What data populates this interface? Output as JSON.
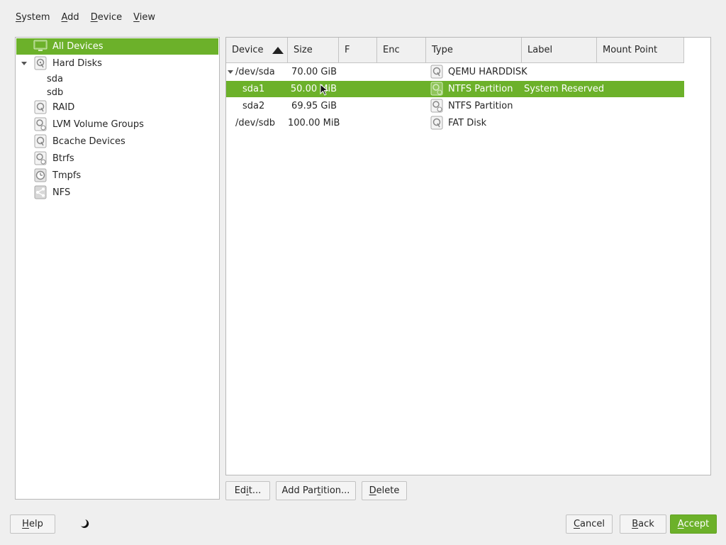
{
  "menubar": [
    {
      "mnemonic": "S",
      "rest": "ystem"
    },
    {
      "mnemonic": "A",
      "rest": "dd"
    },
    {
      "mnemonic": "D",
      "rest": "evice"
    },
    {
      "mnemonic": "V",
      "rest": "iew"
    }
  ],
  "tree": {
    "all_devices": "All Devices",
    "hard_disks": "Hard Disks",
    "sda": "sda",
    "sdb": "sdb",
    "raid": "RAID",
    "lvm": "LVM Volume Groups",
    "bcache": "Bcache Devices",
    "btrfs": "Btrfs",
    "tmpfs": "Tmpfs",
    "nfs": "NFS"
  },
  "table": {
    "columns": [
      "Device",
      "Size",
      "F",
      "Enc",
      "Type",
      "Label",
      "Mount Point"
    ],
    "sort_column": "Device",
    "sort_direction": "ascending",
    "rows": [
      {
        "device": "/dev/sda",
        "size": "70.00 GiB",
        "f": "",
        "enc": "",
        "type": "QEMU HARDDISK",
        "label": "",
        "mount": ""
      },
      {
        "device": "sda1",
        "size": "50.00 MiB",
        "f": "",
        "enc": "",
        "type": "NTFS Partition",
        "label": "System Reserved",
        "mount": ""
      },
      {
        "device": "sda2",
        "size": "69.95 GiB",
        "f": "",
        "enc": "",
        "type": "NTFS Partition",
        "label": "",
        "mount": ""
      },
      {
        "device": "/dev/sdb",
        "size": "100.00 MiB",
        "f": "",
        "enc": "",
        "type": "FAT Disk",
        "label": "",
        "mount": ""
      }
    ],
    "selected_row": "sda1"
  },
  "actions": {
    "edit": {
      "pre": "Ed",
      "mnemonic": "i",
      "post": "t..."
    },
    "add_partition": {
      "pre": "Add Par",
      "mnemonic": "t",
      "post": "ition..."
    },
    "delete": {
      "pre": "",
      "mnemonic": "D",
      "post": "elete"
    }
  },
  "footer": {
    "help": {
      "mnemonic": "H",
      "rest": "elp"
    },
    "cancel": {
      "mnemonic": "C",
      "rest": "ancel"
    },
    "back": {
      "mnemonic": "B",
      "rest": "ack"
    },
    "accept": {
      "mnemonic": "A",
      "rest": "ccept"
    }
  },
  "icons": {
    "tree": [
      "monitor-icon",
      "hard-disk-icon",
      "raid-icon",
      "lvm-icon",
      "bcache-icon",
      "btrfs-icon",
      "tmpfs-icon",
      "nfs-icon"
    ],
    "footer": "moon-icon",
    "pointer": "mouse-cursor-icon"
  },
  "colors": {
    "accent": "#6cb12a",
    "background": "#efefef"
  }
}
